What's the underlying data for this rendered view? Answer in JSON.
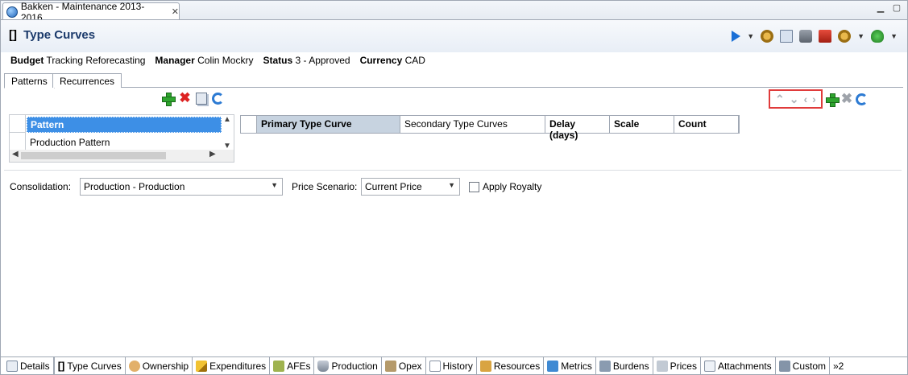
{
  "window": {
    "tab_title": "Bakken - Maintenance 2013-2016",
    "close_glyph": "✕"
  },
  "header": {
    "bracket": "[]",
    "title": "Type Curves"
  },
  "summary": {
    "budget_label": "Budget",
    "budget_value": "Tracking",
    "budget_extra": "Reforecasting",
    "manager_label": "Manager",
    "manager_value": "Colin Mockry",
    "status_label": "Status",
    "status_value": "3 - Approved",
    "currency_label": "Currency",
    "currency_value": "CAD"
  },
  "subtabs": {
    "patterns": "Patterns",
    "recurrences": "Recurrences"
  },
  "pattern_table": {
    "header": "Pattern",
    "rows": [
      "Production Pattern"
    ]
  },
  "curve_table": {
    "columns": [
      "Primary Type Curve",
      "Secondary Type Curves",
      "Delay (days)",
      "Scale",
      "Count"
    ]
  },
  "form": {
    "consolidation_label": "Consolidation:",
    "consolidation_value": "Production - Production",
    "price_scenario_label": "Price Scenario:",
    "price_scenario_value": "Current Price",
    "apply_royalty_label": "Apply Royalty",
    "apply_royalty_checked": false
  },
  "bottom_tabs": [
    "Details",
    "Type Curves",
    "Ownership",
    "Expenditures",
    "AFEs",
    "Production",
    "Opex",
    "History",
    "Resources",
    "Metrics",
    "Burdens",
    "Prices",
    "Attachments",
    "Custom"
  ],
  "bottom_tabs_active": "Type Curves",
  "more_tabs": "»2",
  "colors": {
    "accent": "#3d8fe6",
    "title": "#1b3a6b",
    "highlight_box": "#e03b3b"
  }
}
